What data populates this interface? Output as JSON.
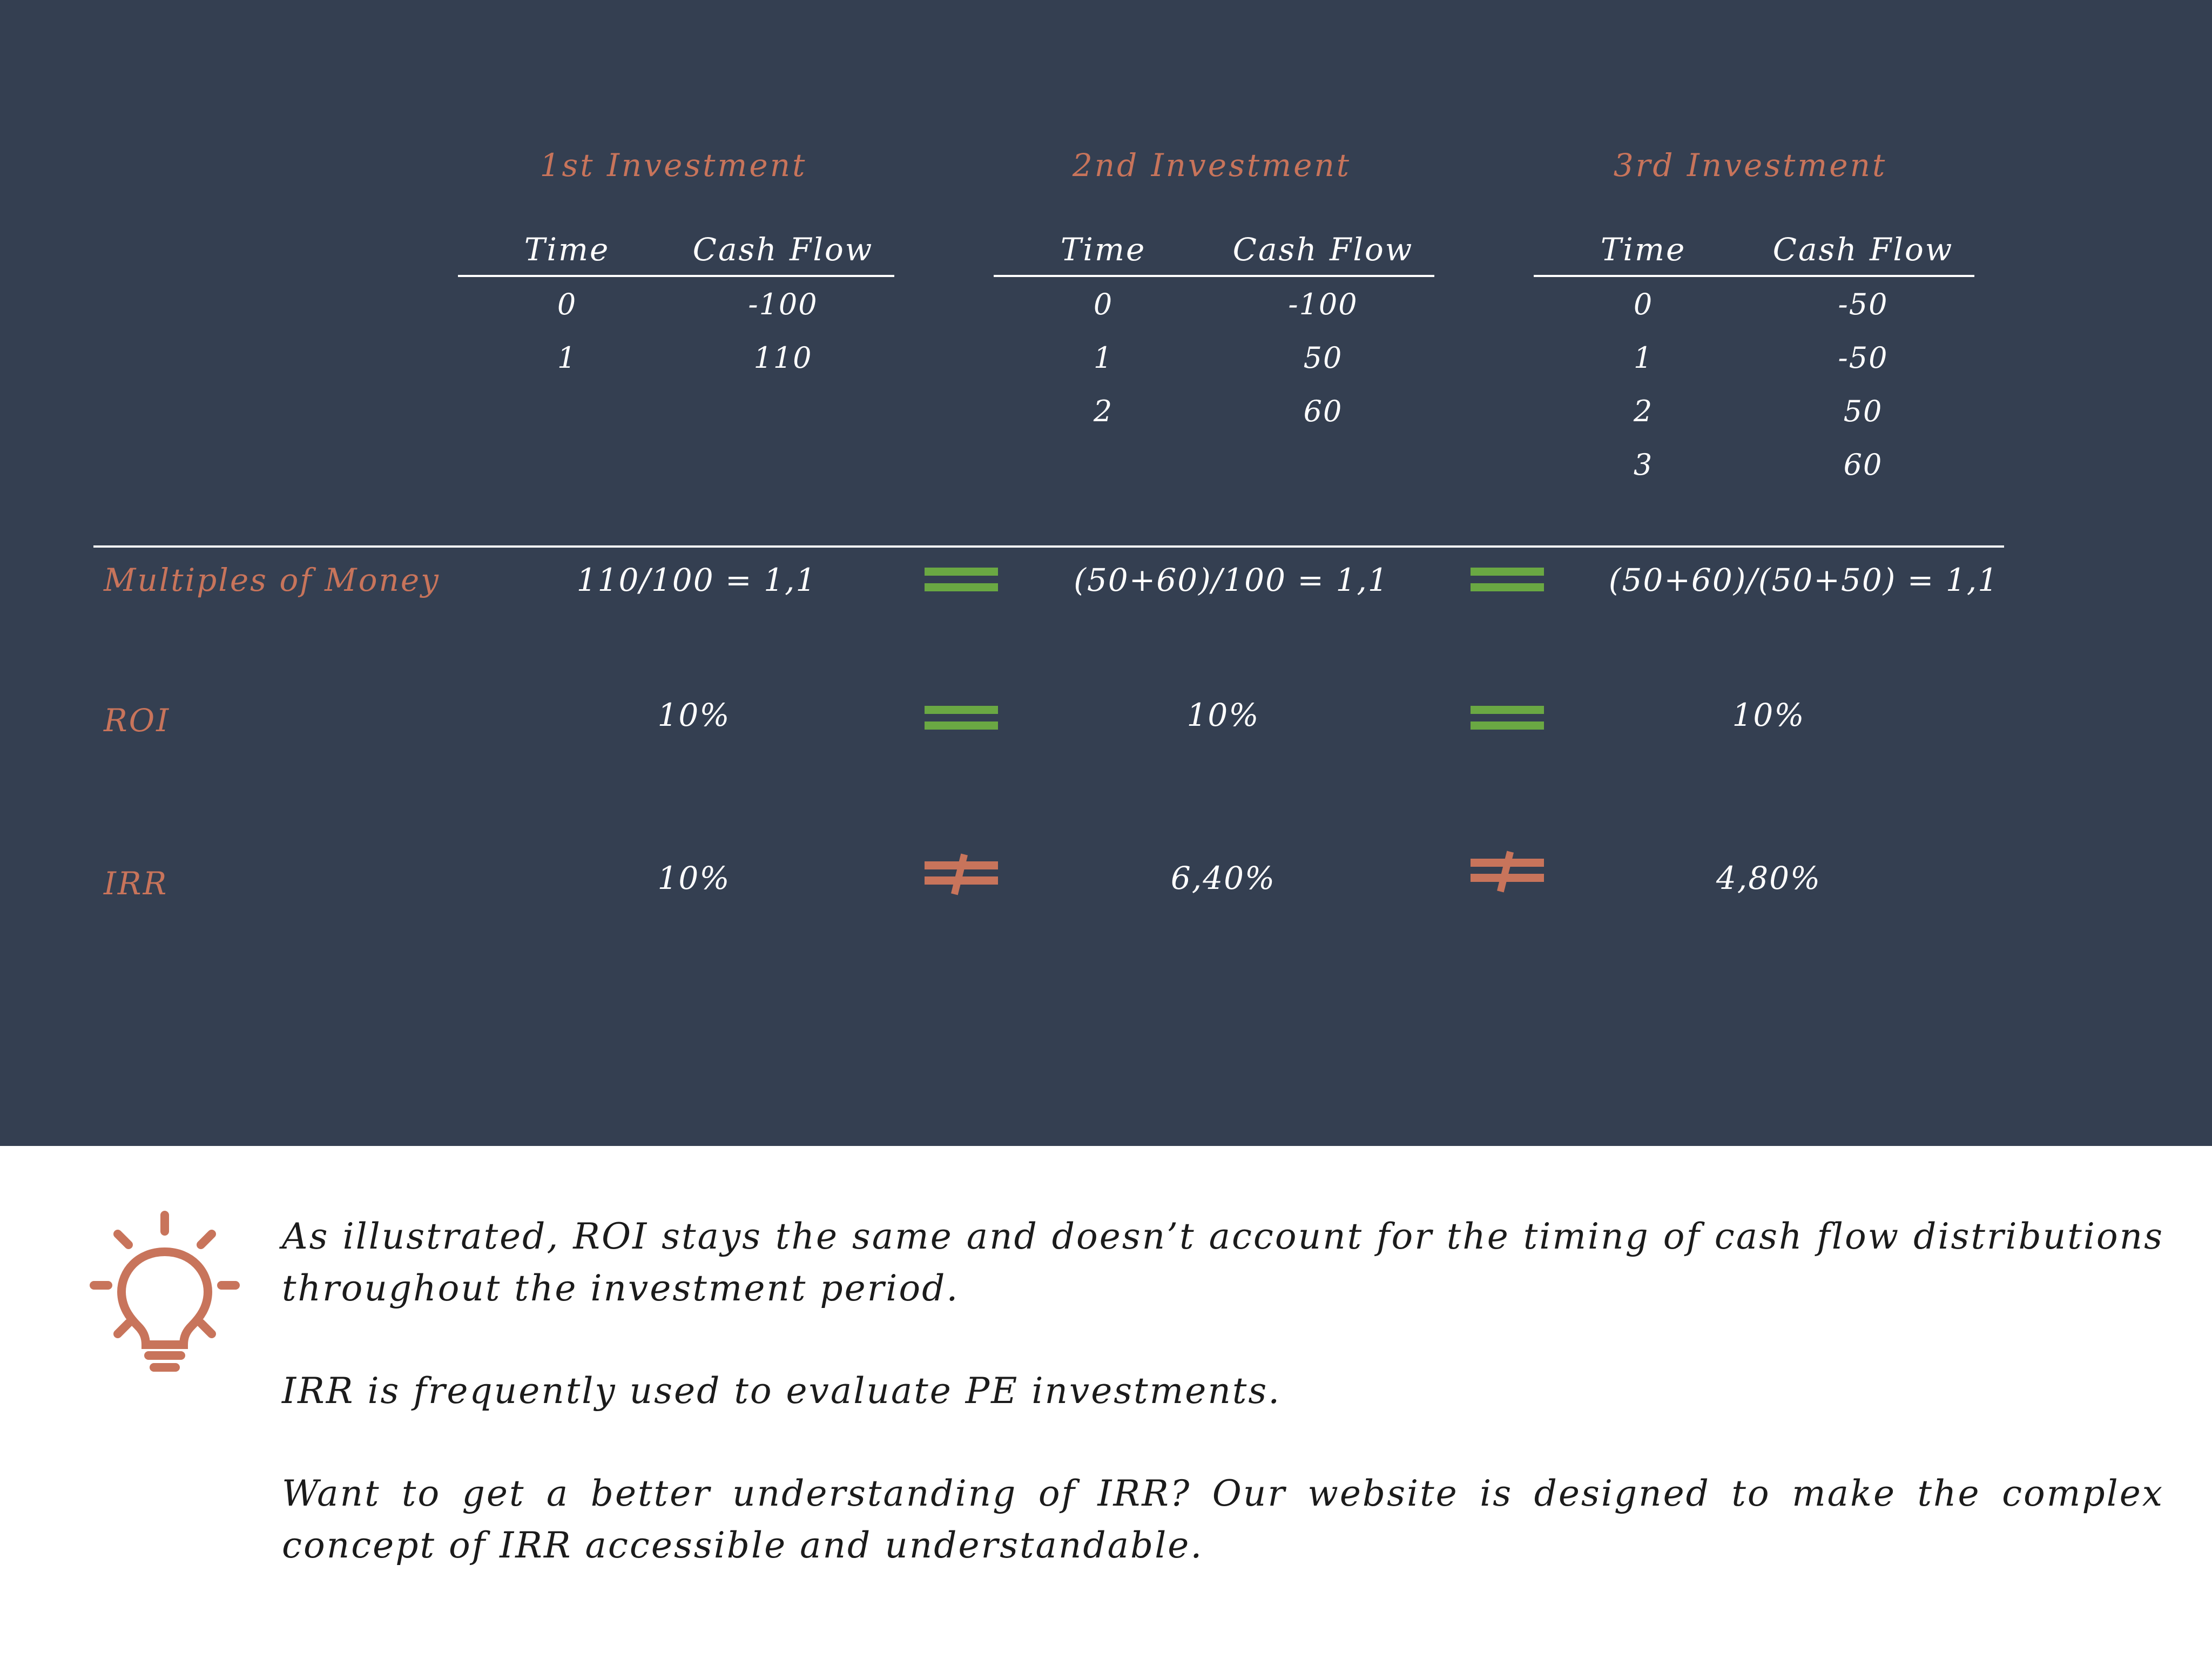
{
  "investments": [
    {
      "title": "1st Investment",
      "headers": [
        "Time",
        "Cash Flow"
      ],
      "rows": [
        [
          "0",
          "-100"
        ],
        [
          "1",
          "110"
        ]
      ]
    },
    {
      "title": "2nd Investment",
      "headers": [
        "Time",
        "Cash Flow"
      ],
      "rows": [
        [
          "0",
          "-100"
        ],
        [
          "1",
          "50"
        ],
        [
          "2",
          "60"
        ]
      ]
    },
    {
      "title": "3rd Investment",
      "headers": [
        "Time",
        "Cash Flow"
      ],
      "rows": [
        [
          "0",
          "-50"
        ],
        [
          "1",
          "-50"
        ],
        [
          "2",
          "50"
        ],
        [
          "3",
          "60"
        ]
      ]
    }
  ],
  "metrics": [
    {
      "label": "Multiples of Money",
      "values": [
        "110/100 = 1,1",
        "(50+60)/100 = 1,1",
        "(50+60)/(50+50) = 1,1"
      ],
      "comparisons": [
        "equal",
        "equal"
      ]
    },
    {
      "label": "ROI",
      "values": [
        "10%",
        "10%",
        "10%"
      ],
      "comparisons": [
        "equal",
        "equal"
      ]
    },
    {
      "label": "IRR",
      "values": [
        "10%",
        "6,40%",
        "4,80%"
      ],
      "comparisons": [
        "not-equal",
        "not-equal"
      ]
    }
  ],
  "note": {
    "icon": "lightbulb-icon",
    "paragraphs": [
      "As illustrated, ROI stays the same and doesn’t account for the timing of cash flow distributions throughout the investment period.",
      "IRR is frequently used to evaluate PE investments.",
      "Want to get a better understanding of IRR? Our website is designed to make the complex concept of IRR accessible and understandable."
    ]
  },
  "colors": {
    "background_dark": "#343f51",
    "accent_orange": "#c8745b",
    "equal_green": "#6aa843",
    "text_white": "#ffffff",
    "text_dark": "#1b1b1b"
  }
}
